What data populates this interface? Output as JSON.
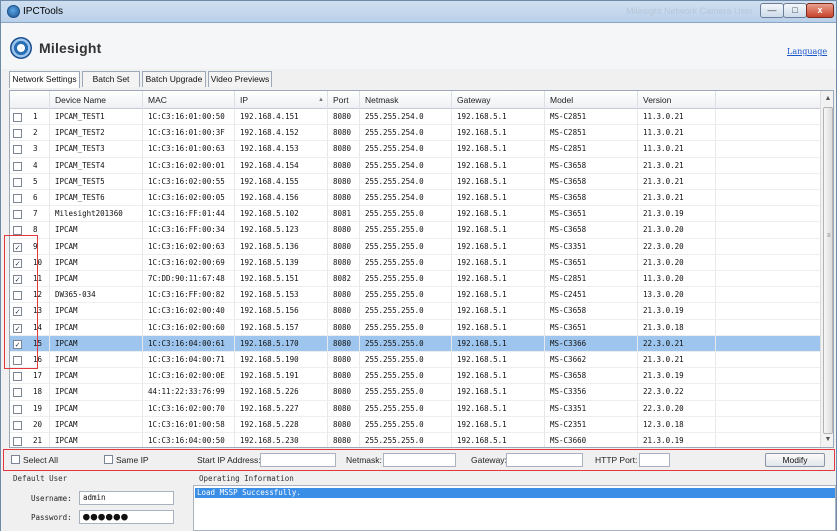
{
  "window": {
    "title": "IPCTools",
    "background_text": "Milesight Network Camera User Manual en V1.0 - Microsoft Word",
    "min_label": "—",
    "max_label": "□",
    "close_label": "x"
  },
  "header": {
    "brand": "Milesight",
    "language_link": "Language"
  },
  "tabs": [
    {
      "label": "Network Settings",
      "active": true
    },
    {
      "label": "Batch Set",
      "active": false
    },
    {
      "label": "Batch Upgrade",
      "active": false
    },
    {
      "label": "Video Previews",
      "active": false
    }
  ],
  "columns": [
    "",
    "Device Name",
    "MAC",
    "IP",
    "Port",
    "Netmask",
    "Gateway",
    "Model",
    "Version"
  ],
  "rows": [
    {
      "checked": false,
      "no": "1",
      "name": "IPCAM_TEST1",
      "mac": "1C:C3:16:01:00:50",
      "ip": "192.168.4.151",
      "port": "8080",
      "netmask": "255.255.254.0",
      "gateway": "192.168.5.1",
      "model": "MS-C2851",
      "version": "11.3.0.21"
    },
    {
      "checked": false,
      "no": "2",
      "name": "IPCAM_TEST2",
      "mac": "1C:C3:16:01:00:3F",
      "ip": "192.168.4.152",
      "port": "8080",
      "netmask": "255.255.254.0",
      "gateway": "192.168.5.1",
      "model": "MS-C2851",
      "version": "11.3.0.21"
    },
    {
      "checked": false,
      "no": "3",
      "name": "IPCAM_TEST3",
      "mac": "1C:C3:16:01:00:63",
      "ip": "192.168.4.153",
      "port": "8080",
      "netmask": "255.255.254.0",
      "gateway": "192.168.5.1",
      "model": "MS-C2851",
      "version": "11.3.0.21"
    },
    {
      "checked": false,
      "no": "4",
      "name": "IPCAM_TEST4",
      "mac": "1C:C3:16:02:00:01",
      "ip": "192.168.4.154",
      "port": "8080",
      "netmask": "255.255.254.0",
      "gateway": "192.168.5.1",
      "model": "MS-C3658",
      "version": "21.3.0.21"
    },
    {
      "checked": false,
      "no": "5",
      "name": "IPCAM_TEST5",
      "mac": "1C:C3:16:02:00:55",
      "ip": "192.168.4.155",
      "port": "8080",
      "netmask": "255.255.254.0",
      "gateway": "192.168.5.1",
      "model": "MS-C3658",
      "version": "21.3.0.21"
    },
    {
      "checked": false,
      "no": "6",
      "name": "IPCAM_TEST6",
      "mac": "1C:C3:16:02:00:05",
      "ip": "192.168.4.156",
      "port": "8080",
      "netmask": "255.255.254.0",
      "gateway": "192.168.5.1",
      "model": "MS-C3658",
      "version": "21.3.0.21"
    },
    {
      "checked": false,
      "no": "7",
      "name": "Milesight201360",
      "mac": "1C:C3:16:FF:01:44",
      "ip": "192.168.5.102",
      "port": "8081",
      "netmask": "255.255.255.0",
      "gateway": "192.168.5.1",
      "model": "MS-C3651",
      "version": "21.3.0.19"
    },
    {
      "checked": false,
      "no": "8",
      "name": "IPCAM",
      "mac": "1C:C3:16:FF:00:34",
      "ip": "192.168.5.123",
      "port": "8080",
      "netmask": "255.255.255.0",
      "gateway": "192.168.5.1",
      "model": "MS-C3658",
      "version": "21.3.0.20"
    },
    {
      "checked": true,
      "no": "9",
      "name": "IPCAM",
      "mac": "1C:C3:16:02:00:63",
      "ip": "192.168.5.136",
      "port": "8080",
      "netmask": "255.255.255.0",
      "gateway": "192.168.5.1",
      "model": "MS-C3351",
      "version": "22.3.0.20"
    },
    {
      "checked": true,
      "no": "10",
      "name": "IPCAM",
      "mac": "1C:C3:16:02:00:69",
      "ip": "192.168.5.139",
      "port": "8080",
      "netmask": "255.255.255.0",
      "gateway": "192.168.5.1",
      "model": "MS-C3651",
      "version": "21.3.0.20"
    },
    {
      "checked": true,
      "no": "11",
      "name": "IPCAM",
      "mac": "7C:DD:90:11:67:48",
      "ip": "192.168.5.151",
      "port": "8082",
      "netmask": "255.255.255.0",
      "gateway": "192.168.5.1",
      "model": "MS-C2851",
      "version": "11.3.0.20"
    },
    {
      "checked": false,
      "no": "12",
      "name": "DW365-034",
      "mac": "1C:C3:16:FF:00:82",
      "ip": "192.168.5.153",
      "port": "8080",
      "netmask": "255.255.255.0",
      "gateway": "192.168.5.1",
      "model": "MS-C2451",
      "version": "13.3.0.20"
    },
    {
      "checked": true,
      "no": "13",
      "name": "IPCAM",
      "mac": "1C:C3:16:02:00:40",
      "ip": "192.168.5.156",
      "port": "8080",
      "netmask": "255.255.255.0",
      "gateway": "192.168.5.1",
      "model": "MS-C3658",
      "version": "21.3.0.19"
    },
    {
      "checked": true,
      "no": "14",
      "name": "IPCAM",
      "mac": "1C:C3:16:02:00:60",
      "ip": "192.168.5.157",
      "port": "8080",
      "netmask": "255.255.255.0",
      "gateway": "192.168.5.1",
      "model": "MS-C3651",
      "version": "21.3.0.18"
    },
    {
      "checked": true,
      "no": "15",
      "name": "IPCAM",
      "mac": "1C:C3:16:04:00:61",
      "ip": "192.168.5.170",
      "port": "8080",
      "netmask": "255.255.255.0",
      "gateway": "192.168.5.1",
      "model": "MS-C3366",
      "version": "22.3.0.21",
      "selected": true
    },
    {
      "checked": false,
      "no": "16",
      "name": "IPCAM",
      "mac": "1C:C3:16:04:00:71",
      "ip": "192.168.5.190",
      "port": "8080",
      "netmask": "255.255.255.0",
      "gateway": "192.168.5.1",
      "model": "MS-C3662",
      "version": "21.3.0.21"
    },
    {
      "checked": false,
      "no": "17",
      "name": "IPCAM",
      "mac": "1C:C3:16:02:00:0E",
      "ip": "192.168.5.191",
      "port": "8080",
      "netmask": "255.255.255.0",
      "gateway": "192.168.5.1",
      "model": "MS-C3658",
      "version": "21.3.0.19"
    },
    {
      "checked": false,
      "no": "18",
      "name": "IPCAM",
      "mac": "44:11:22:33:76:99",
      "ip": "192.168.5.226",
      "port": "8080",
      "netmask": "255.255.255.0",
      "gateway": "192.168.5.1",
      "model": "MS-C3356",
      "version": "22.3.0.22"
    },
    {
      "checked": false,
      "no": "19",
      "name": "IPCAM",
      "mac": "1C:C3:16:02:00:70",
      "ip": "192.168.5.227",
      "port": "8080",
      "netmask": "255.255.255.0",
      "gateway": "192.168.5.1",
      "model": "MS-C3351",
      "version": "22.3.0.20"
    },
    {
      "checked": false,
      "no": "20",
      "name": "IPCAM",
      "mac": "1C:C3:16:01:00:58",
      "ip": "192.168.5.228",
      "port": "8080",
      "netmask": "255.255.255.0",
      "gateway": "192.168.5.1",
      "model": "MS-C2351",
      "version": "12.3.0.18"
    },
    {
      "checked": false,
      "no": "21",
      "name": "IPCAM",
      "mac": "1C:C3:16:04:00:50",
      "ip": "192.168.5.230",
      "port": "8080",
      "netmask": "255.255.255.0",
      "gateway": "192.168.5.1",
      "model": "MS-C3660",
      "version": "21.3.0.19"
    }
  ],
  "actions": {
    "select_all": "Select All",
    "same_ip": "Same IP",
    "start_ip_label": "Start IP Address:",
    "start_ip_value": "",
    "netmask_label": "Netmask:",
    "netmask_value": "",
    "gateway_label": "Gateway:",
    "gateway_value": "",
    "http_port_label": "HTTP Port:",
    "http_port_value": "",
    "modify_label": "Modify"
  },
  "default_user": {
    "title": "Default User",
    "username_label": "Username:",
    "username_value": "admin",
    "password_label": "Password:",
    "password_value": "●●●●●●"
  },
  "operating_info": {
    "title": "Operating Information",
    "lines": [
      "Load MSSP Successfully."
    ]
  },
  "colors": {
    "highlight_box": "#e2383b",
    "selected_row": "#9dc5ee",
    "log_highlight": "#3a8ee6"
  }
}
